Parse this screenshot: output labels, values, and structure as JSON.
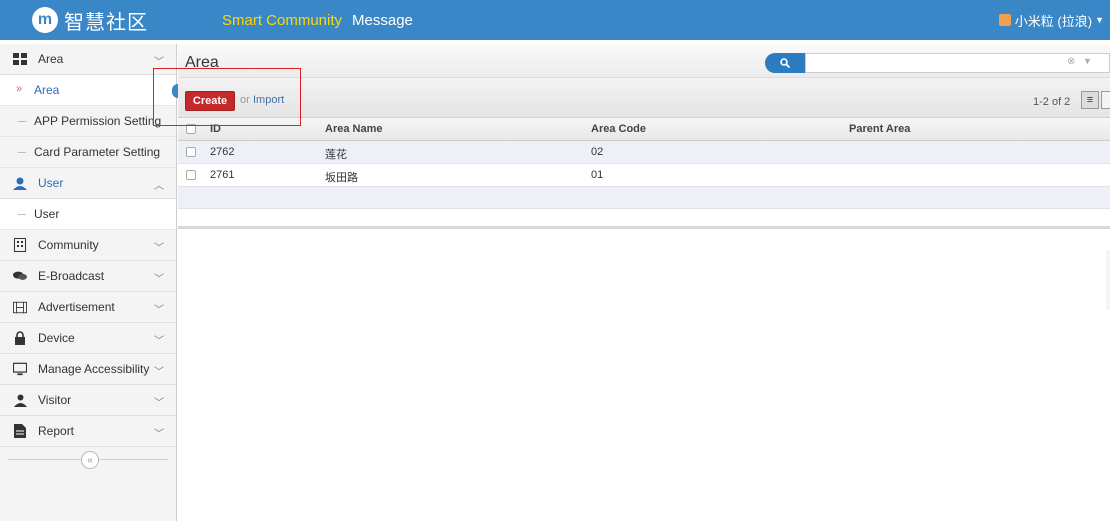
{
  "app": {
    "logo_text": "智慧社区",
    "logo_mark": "m"
  },
  "topnav": {
    "items": [
      {
        "label": "Smart Community"
      },
      {
        "label": "Message"
      }
    ]
  },
  "user": {
    "name": "小米粒 (拉浪)"
  },
  "sidebar": {
    "groups": [
      {
        "label": "Area",
        "icon": "grid-icon",
        "expanded": true,
        "items": [
          {
            "label": "Area",
            "active": true
          },
          {
            "label": "APP Permission Setting"
          },
          {
            "label": "Card Parameter Setting"
          }
        ]
      },
      {
        "label": "User",
        "icon": "user-icon",
        "expanded": true,
        "items": [
          {
            "label": "User"
          }
        ]
      },
      {
        "label": "Community",
        "icon": "building-icon"
      },
      {
        "label": "E-Broadcast",
        "icon": "chat-icon"
      },
      {
        "label": "Advertisement",
        "icon": "film-icon"
      },
      {
        "label": "Device",
        "icon": "lock-icon"
      },
      {
        "label": "Manage Accessibility",
        "icon": "monitor-icon"
      },
      {
        "label": "Visitor",
        "icon": "person-icon"
      },
      {
        "label": "Report",
        "icon": "document-icon"
      }
    ],
    "collapse_symbol": "«"
  },
  "main": {
    "title": "Area",
    "search": {
      "placeholder": "",
      "value": ""
    },
    "toolbar": {
      "create_label": "Create",
      "or_label": "or",
      "import_label": "Import",
      "pager": "1-2 of 2"
    },
    "table": {
      "columns": [
        "ID",
        "Area Name",
        "Area Code",
        "Parent Area"
      ],
      "rows": [
        {
          "id": "2762",
          "name": "莲花",
          "code": "02",
          "parent": ""
        },
        {
          "id": "2761",
          "name": "坂田路",
          "code": "01",
          "parent": ""
        }
      ]
    }
  },
  "colors": {
    "topbar": "#3a87c8",
    "nav_accent": "#ffd700",
    "create_button": "#c42a2a",
    "highlight": "#e02020"
  }
}
